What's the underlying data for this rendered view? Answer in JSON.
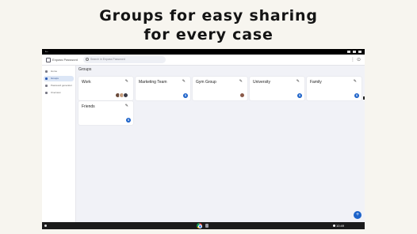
{
  "hero": {
    "line1": "Groups for easy sharing",
    "line2": "for every case"
  },
  "app": {
    "title": "Enpass Password",
    "search_placeholder": "Search in Enpass Password"
  },
  "sidebar": {
    "items": [
      {
        "label": "Home",
        "icon": "home-icon",
        "active": false
      },
      {
        "label": "Groups",
        "icon": "groups-icon",
        "active": true
      },
      {
        "label": "Password generator",
        "icon": "key-icon",
        "active": false
      },
      {
        "label": "Overview",
        "icon": "shield-icon",
        "active": false
      }
    ]
  },
  "main": {
    "heading": "Groups",
    "groups": [
      {
        "name": "Work",
        "members": "avatars"
      },
      {
        "name": "Marketing Team",
        "members": "S"
      },
      {
        "name": "Gym Group",
        "members": "avatar"
      },
      {
        "name": "University",
        "members": "S"
      },
      {
        "name": "Family",
        "members": "S"
      },
      {
        "name": "Friends",
        "members": "S"
      }
    ]
  },
  "fab": {
    "label": "+"
  },
  "shelf": {
    "time": "10:49"
  },
  "colors": {
    "accent": "#1d63c9",
    "background": "#f7f5ef",
    "app_background": "#f1f2f7"
  }
}
